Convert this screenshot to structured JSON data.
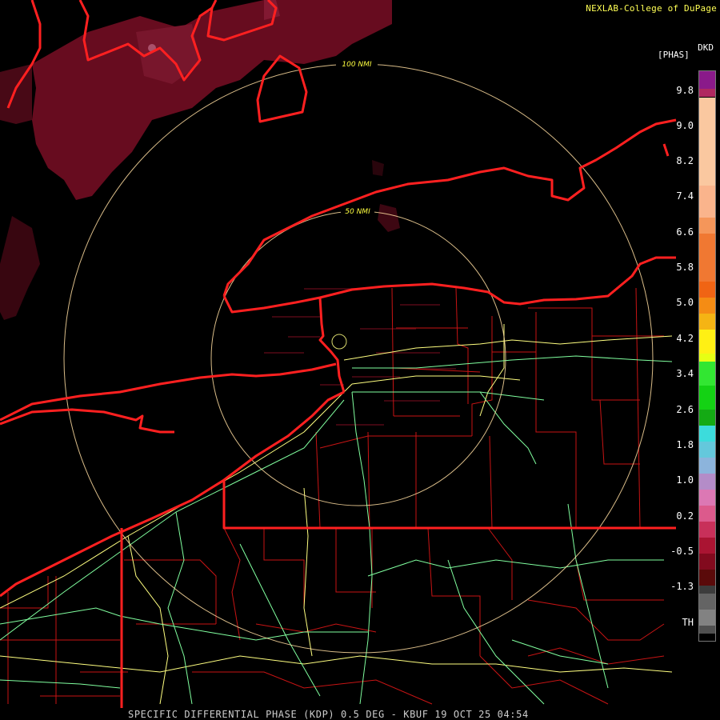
{
  "credit": "NEXLAB-College of DuPage",
  "product_code": "DKD",
  "units": "[PHAS]",
  "range_rings": [
    "100 NMI",
    "50 NMI"
  ],
  "legend": {
    "ticks": [
      "9.8",
      "9.0",
      "8.2",
      "7.4",
      "6.6",
      "5.8",
      "5.0",
      "4.2",
      "3.4",
      "2.6",
      "1.8",
      "1.0",
      "0.2",
      "-0.5",
      "-1.3",
      "TH"
    ]
  },
  "footer": "SPECIFIC DIFFERENTIAL PHASE (KDP) 0.5 DEG - KBUF 19 OCT 25 04:54",
  "colors": {
    "background": "#000000",
    "state_border": "#ff2020",
    "county_border": "#c81414",
    "highway_yellow": "#ffff80",
    "highway_green": "#80ff9f",
    "range_ring": "#ffdda0",
    "echo": "#7a0f25",
    "credit_text": "#ffff55"
  }
}
